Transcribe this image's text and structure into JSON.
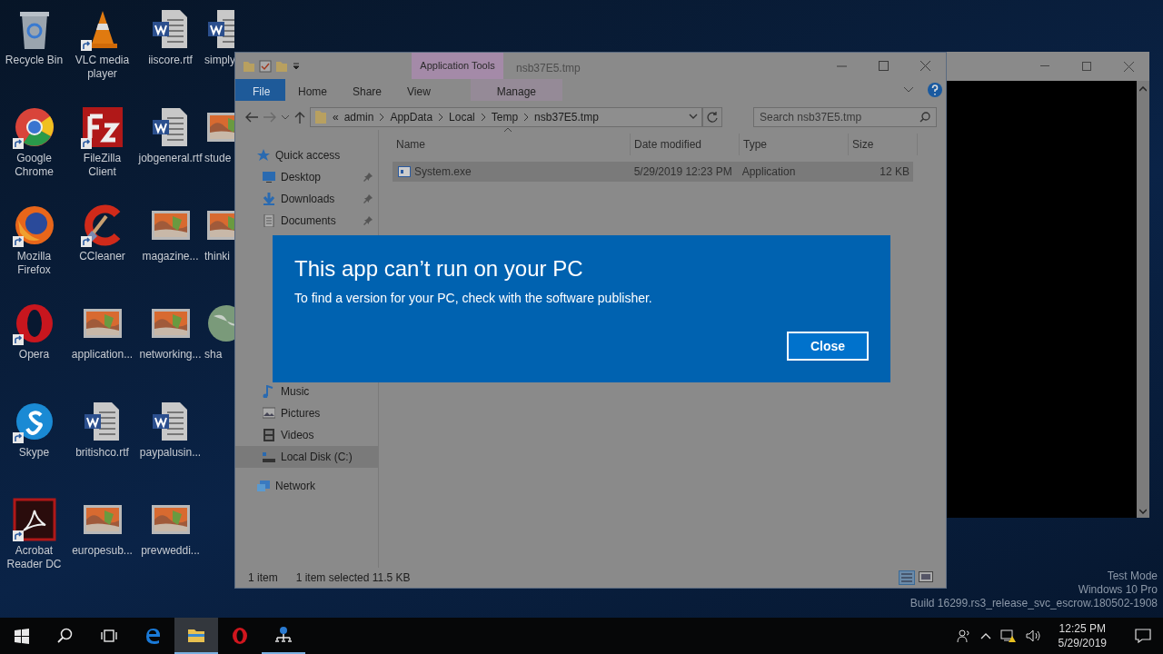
{
  "desktop": {
    "rows": [
      [
        {
          "label": "Recycle Bin",
          "kind": "recycle",
          "shortcut": false
        },
        {
          "label": "VLC media player",
          "kind": "vlc",
          "shortcut": true
        },
        {
          "label": "iiscore.rtf",
          "kind": "word",
          "shortcut": false
        },
        {
          "label": "simply",
          "kind": "word",
          "shortcut": false
        }
      ],
      [
        {
          "label": "Google Chrome",
          "kind": "chrome",
          "shortcut": true
        },
        {
          "label": "FileZilla Client",
          "kind": "filezilla",
          "shortcut": true
        },
        {
          "label": "jobgeneral.rtf",
          "kind": "word",
          "shortcut": false
        },
        {
          "label": "stude",
          "kind": "image",
          "shortcut": false
        }
      ],
      [
        {
          "label": "Mozilla Firefox",
          "kind": "firefox",
          "shortcut": true
        },
        {
          "label": "CCleaner",
          "kind": "ccleaner",
          "shortcut": true
        },
        {
          "label": "magazine...",
          "kind": "image",
          "shortcut": false
        },
        {
          "label": "thinki",
          "kind": "image",
          "shortcut": false
        }
      ],
      [
        {
          "label": "Opera",
          "kind": "opera",
          "shortcut": true
        },
        {
          "label": "application...",
          "kind": "image",
          "shortcut": false
        },
        {
          "label": "networking...",
          "kind": "image",
          "shortcut": false
        },
        {
          "label": "sha",
          "kind": "globe",
          "shortcut": false
        }
      ],
      [
        {
          "label": "Skype",
          "kind": "skype",
          "shortcut": true
        },
        {
          "label": "britishco.rtf",
          "kind": "word",
          "shortcut": false
        },
        {
          "label": "paypalusin...",
          "kind": "word",
          "shortcut": false
        }
      ],
      [
        {
          "label": "Acrobat Reader DC",
          "kind": "acrobat",
          "shortcut": true
        },
        {
          "label": "europesub...",
          "kind": "image",
          "shortcut": false
        },
        {
          "label": "prevweddi...",
          "kind": "image",
          "shortcut": false
        }
      ]
    ],
    "system_text": [
      "Test Mode",
      "Windows 10 Pro",
      "Build 16299.rs3_release_svc_escrow.180502-1908"
    ]
  },
  "explorer": {
    "title": "nsb37E5.tmp",
    "context_group": "Application Tools",
    "tabs": [
      {
        "label": "File",
        "kind": "file",
        "selected": false
      },
      {
        "label": "Home",
        "kind": "tab",
        "selected": false
      },
      {
        "label": "Share",
        "kind": "tab",
        "selected": false
      },
      {
        "label": "View",
        "kind": "tab",
        "selected": false
      },
      {
        "label": "Manage",
        "kind": "context",
        "selected": false
      }
    ],
    "address": {
      "overflow": "«",
      "parts": [
        "admin",
        "AppData",
        "Local",
        "Temp",
        "nsb37E5.tmp"
      ]
    },
    "search": {
      "placeholder": "Search nsb37E5.tmp"
    },
    "sidebar": [
      {
        "label": "Quick access",
        "kind": "star",
        "children": [
          {
            "label": "Desktop",
            "kind": "desktop",
            "pinned": true,
            "selected": false
          },
          {
            "label": "Downloads",
            "kind": "downloads",
            "pinned": true,
            "selected": false
          },
          {
            "label": "Documents",
            "kind": "documents",
            "pinned": true,
            "selected": false
          }
        ]
      },
      {
        "kind": "hidden",
        "children": [
          {
            "label": "Music",
            "kind": "music",
            "pinned": false,
            "selected": false
          },
          {
            "label": "Pictures",
            "kind": "pictures",
            "pinned": false,
            "selected": false
          },
          {
            "label": "Videos",
            "kind": "videos",
            "pinned": false,
            "selected": false
          },
          {
            "label": "Local Disk (C:)",
            "kind": "disk",
            "pinned": false,
            "selected": true
          }
        ]
      },
      {
        "label": "Network",
        "kind": "network"
      }
    ],
    "columns": [
      "Name",
      "Date modified",
      "Type",
      "Size"
    ],
    "rows": [
      {
        "cells": [
          "System.exe",
          "5/29/2019 12:23 PM",
          "Application",
          "12 KB"
        ],
        "selected": true
      }
    ],
    "status_bar": {
      "count": "1 item",
      "selection": "1 item selected  11.5 KB"
    }
  },
  "dialog": {
    "title": "This app can’t run on your PC",
    "message": "To find a version for your PC, check with the software publisher.",
    "button": "Close"
  },
  "taskbar": {
    "apps": [
      {
        "kind": "start",
        "running": false,
        "selected": false
      },
      {
        "kind": "search",
        "running": false,
        "selected": false
      },
      {
        "kind": "taskview",
        "running": false,
        "selected": false
      },
      {
        "kind": "edge",
        "running": false,
        "selected": false
      },
      {
        "kind": "explorer",
        "running": true,
        "selected": true
      },
      {
        "kind": "opera",
        "running": false,
        "selected": false
      },
      {
        "kind": "network-app",
        "running": true,
        "selected": false
      }
    ],
    "time": "12:25 PM",
    "date": "5/29/2019"
  }
}
